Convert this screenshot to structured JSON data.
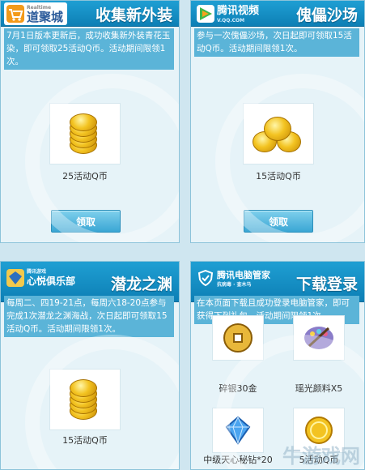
{
  "cards": [
    {
      "title": "收集新外装",
      "logo_sub": "Realtime",
      "logo_text": "道聚城",
      "description": "7月1日版本更新后，成功收集新外装青花玉染，即可领取25活动Q币。活动期间限领1次。",
      "prize_label": "25活动Q币",
      "button_label": "领取"
    },
    {
      "title": "傀儡沙场",
      "logo_text": "腾讯视频",
      "logo_sub": "V.QQ.COM",
      "description": "参与一次傀儡沙场，次日起即可领取15活动Q币。活动期间限领1次。",
      "prize_label": "15活动Q币",
      "button_label": "领取"
    },
    {
      "title": "潜龙之渊",
      "logo_sub": "腾讯游戏",
      "logo_text": "心悦俱乐部",
      "description": "每周二、四19-21点，每周六18-20点参与完成1次潜龙之渊海战，次日起即可领取15活动Q币。活动期间限领1次。",
      "prize_label": "15活动Q币"
    },
    {
      "title": "下载登录",
      "logo_text": "腾讯电脑管家",
      "logo_sub": "抗病毒 · 查木马",
      "description": "在本页面下载且成功登录电脑管家，即可获得下列礼包。活动期间限领1次。",
      "rewards": [
        "碎银30金",
        "瑶光颜料X5",
        "中级天心秘钻*20",
        "5活动Q币"
      ]
    }
  ],
  "watermark": "牛游戏网",
  "colors": {
    "header_blue": "#1590c8",
    "desc_blue": "#5bb4d8",
    "card_bg": "#e6f3f8"
  }
}
